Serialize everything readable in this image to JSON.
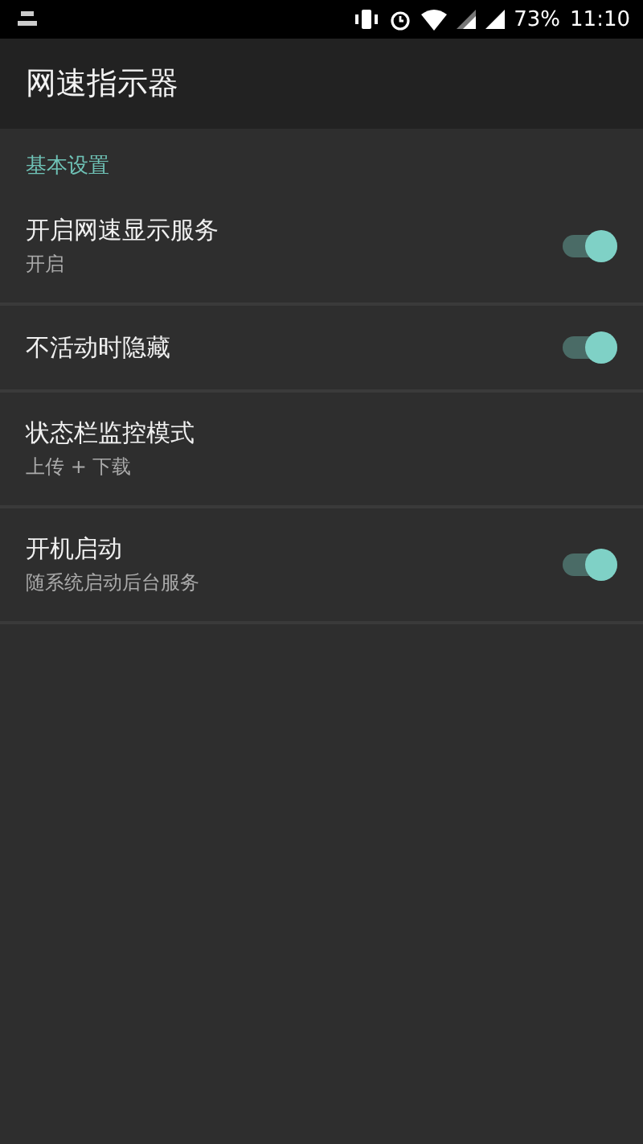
{
  "status_bar": {
    "battery": "73%",
    "time": "11:10"
  },
  "app_bar": {
    "title": "网速指示器"
  },
  "section": {
    "title": "基本设置"
  },
  "settings": [
    {
      "kind": "switch",
      "title": "开启网速显示服务",
      "summary": "开启",
      "on": true
    },
    {
      "kind": "switch",
      "title": "不活动时隐藏",
      "on": true
    },
    {
      "kind": "plain",
      "title": "状态栏监控模式",
      "summary": "上传 + 下载"
    },
    {
      "kind": "switch",
      "title": "开机启动",
      "summary": "随系统启动后台服务",
      "on": true
    }
  ]
}
